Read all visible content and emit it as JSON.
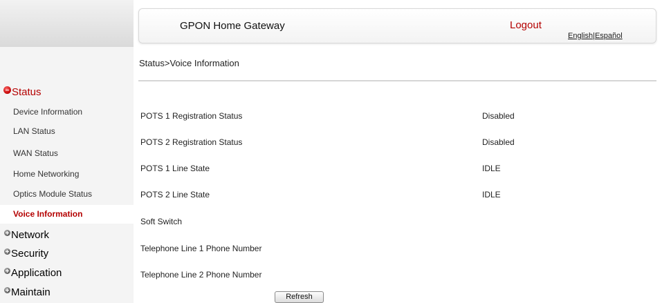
{
  "header": {
    "title": "GPON Home Gateway",
    "logout_label": "Logout",
    "lang_english": "English",
    "lang_separator": "|",
    "lang_espanol": "Español"
  },
  "breadcrumb": "Status>Voice Information",
  "sidebar": {
    "status_label": "Status",
    "status_items": [
      {
        "label": "Device Information",
        "active": false
      },
      {
        "label": "LAN Status",
        "active": false
      },
      {
        "label": "WAN Status",
        "active": false
      },
      {
        "label": "Home Networking",
        "active": false
      },
      {
        "label": "Optics Module Status",
        "active": false
      },
      {
        "label": "Voice Information",
        "active": true
      }
    ],
    "menus": [
      {
        "label": "Network"
      },
      {
        "label": "Security"
      },
      {
        "label": "Application"
      },
      {
        "label": "Maintain"
      }
    ]
  },
  "voice_info": {
    "rows": [
      {
        "label": "POTS 1 Registration Status",
        "value": "Disabled"
      },
      {
        "label": "POTS 2 Registration Status",
        "value": "Disabled"
      },
      {
        "label": "POTS 1 Line State",
        "value": "IDLE"
      },
      {
        "label": "POTS 2 Line State",
        "value": "IDLE"
      },
      {
        "label": "Soft Switch",
        "value": ""
      },
      {
        "label": "Telephone Line 1 Phone Number",
        "value": ""
      },
      {
        "label": "Telephone Line 2 Phone Number",
        "value": ""
      }
    ]
  },
  "refresh_label": "Refresh",
  "colors": {
    "accent_red": "#b40000",
    "sidebar_bg": "#f4f4f4"
  }
}
